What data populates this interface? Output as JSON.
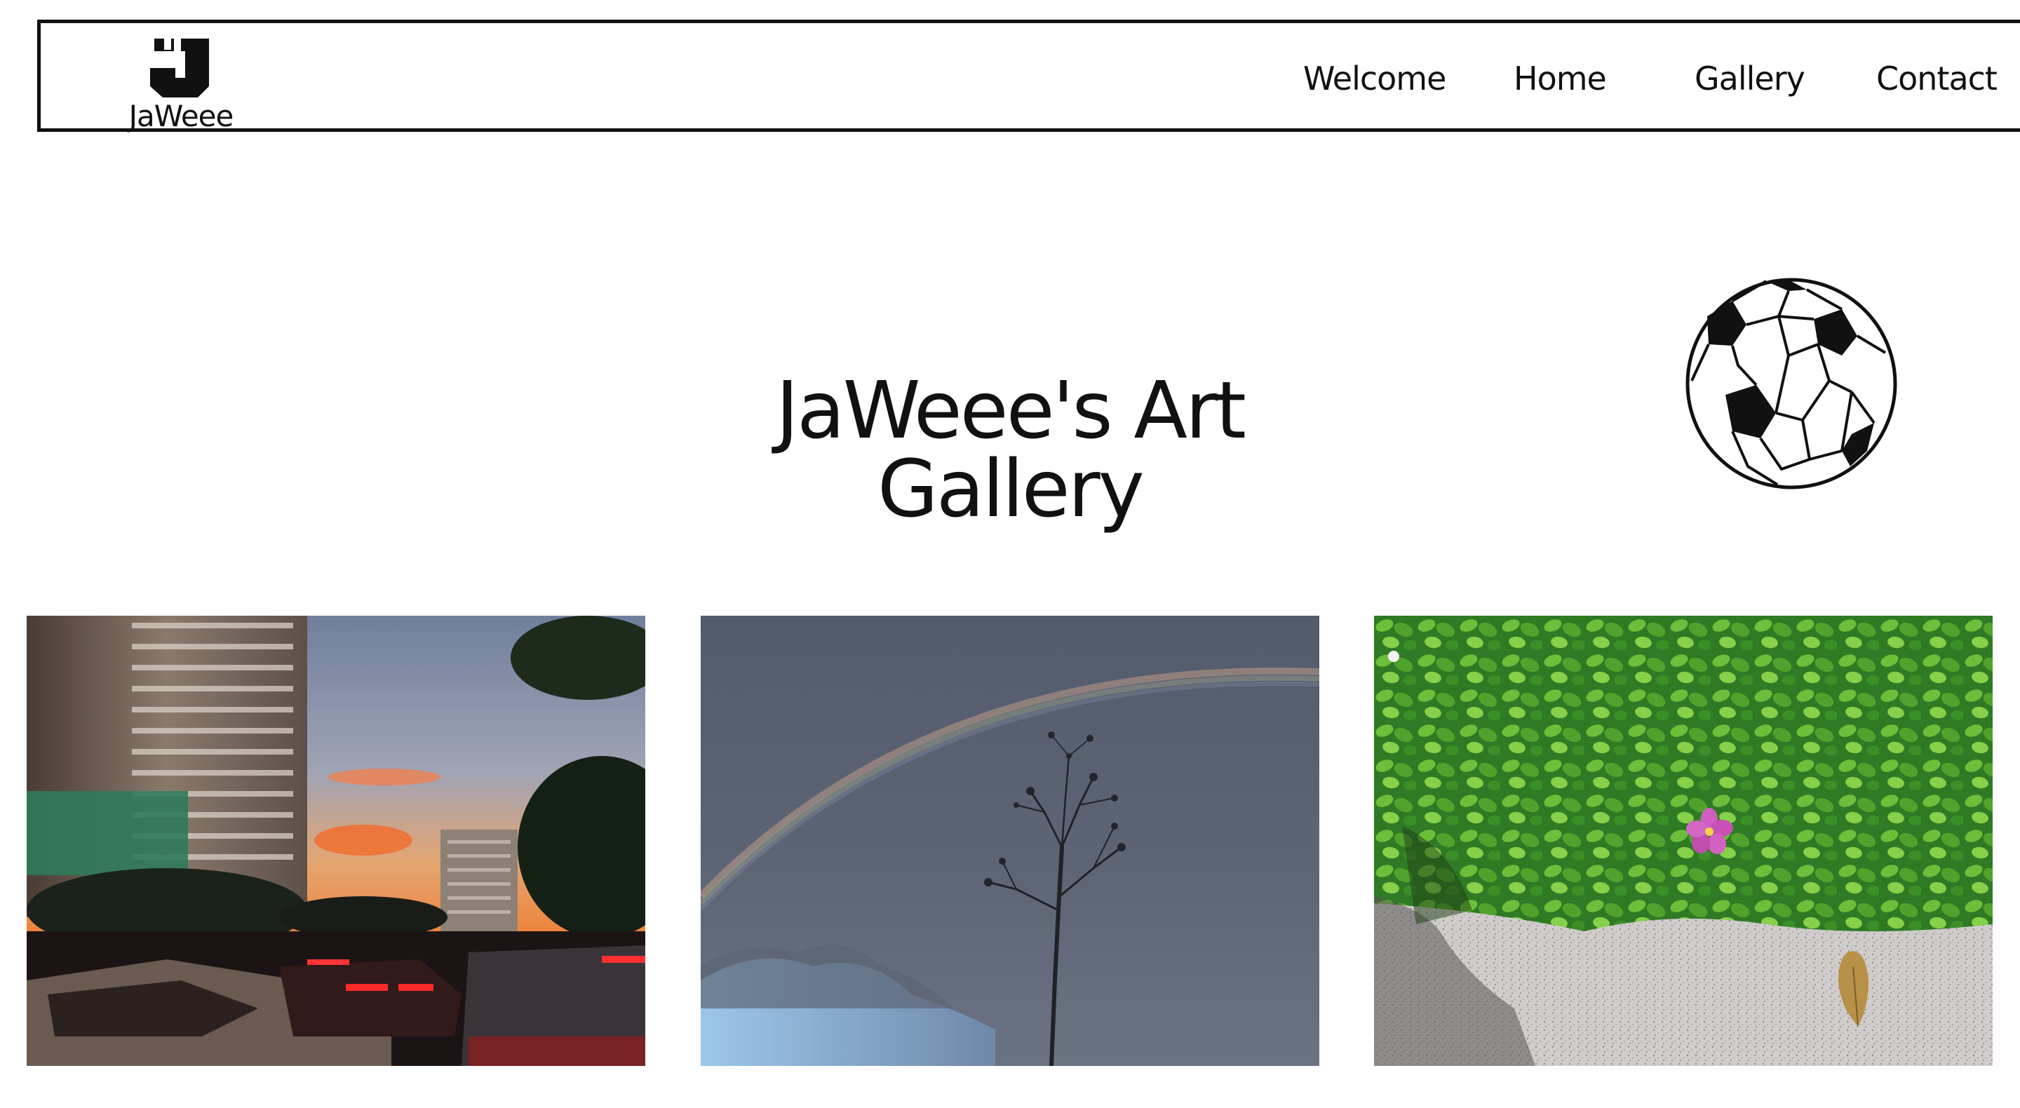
{
  "brand": {
    "name": "JaWeee",
    "logo_icon": "j-block-logo-icon"
  },
  "nav": {
    "items": [
      {
        "label": "Welcome"
      },
      {
        "label": "Home"
      },
      {
        "label": "Gallery"
      },
      {
        "label": "Contact"
      }
    ]
  },
  "main": {
    "title": "JaWeee's Art Gallery",
    "decoration_icon": "soccer-ball-icon"
  },
  "gallery": {
    "photos": [
      {
        "subject": "city-sunset-traffic-photo"
      },
      {
        "subject": "rainbow-tree-sky-photo"
      },
      {
        "subject": "green-plants-pink-flower-photo"
      }
    ]
  },
  "colors": {
    "text": "#111111",
    "border": "#111111",
    "background": "#ffffff"
  }
}
